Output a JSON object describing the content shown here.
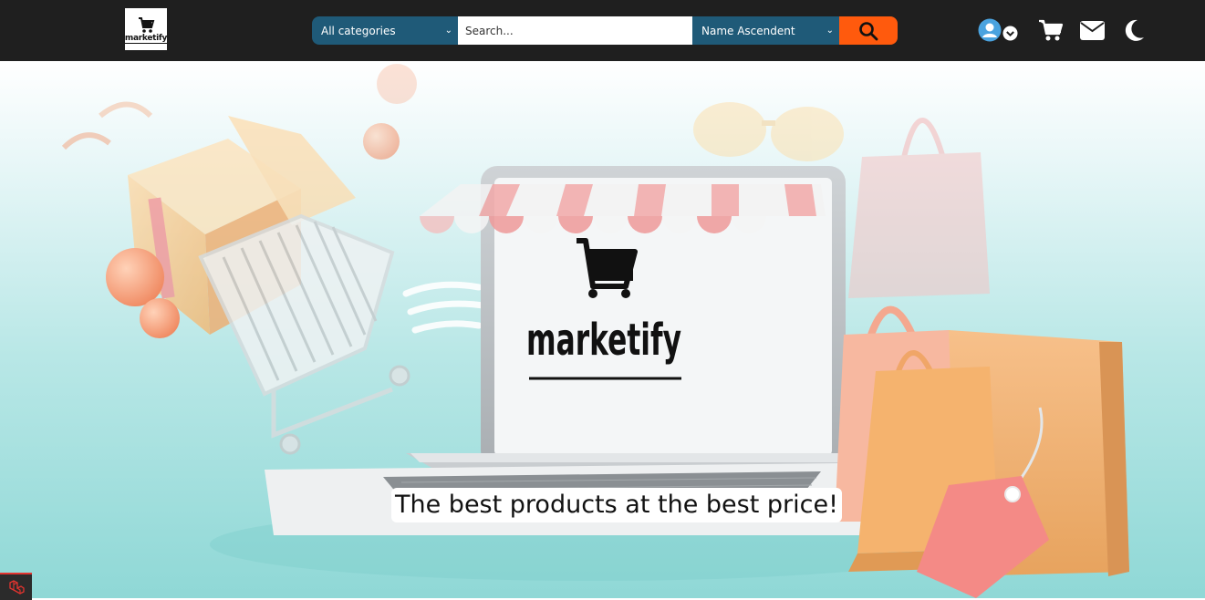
{
  "brand": {
    "logo_text": "marketify",
    "screen_logo_text": "marketify"
  },
  "search": {
    "category_selected": "All categories",
    "placeholder": "Search...",
    "sort_selected": "Name Ascendent"
  },
  "hero": {
    "tagline": "The best products at the best price!"
  },
  "icons": {
    "user": "user-circle-icon",
    "cart": "cart-icon",
    "mail": "envelope-icon",
    "theme": "moon-icon"
  },
  "colors": {
    "navbar": "#1f1f1f",
    "select_bg": "#1f5a78",
    "search_button": "#ff5a0d",
    "avatar": "#4aa3df"
  }
}
